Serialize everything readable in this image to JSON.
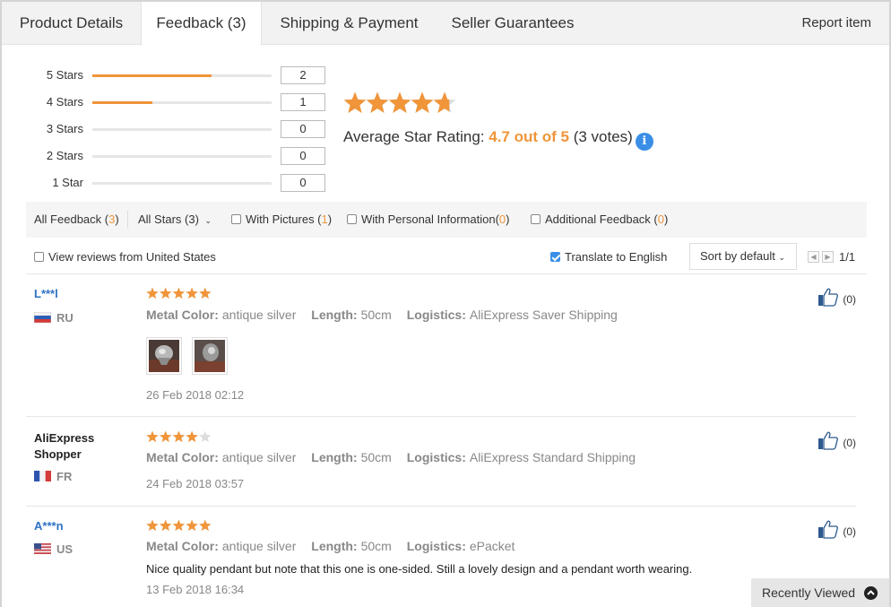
{
  "tabs": [
    {
      "label": "Product Details"
    },
    {
      "label": "Feedback (3)"
    },
    {
      "label": "Shipping & Payment"
    },
    {
      "label": "Seller Guarantees"
    }
  ],
  "active_tab": "Feedback (3)",
  "report_label": "Report item",
  "rating_histogram": [
    {
      "label": "5 Stars",
      "count": "2",
      "fill_fraction": 0.667
    },
    {
      "label": "4 Stars",
      "count": "1",
      "fill_fraction": 0.333
    },
    {
      "label": "3 Stars",
      "count": "0",
      "fill_fraction": 0
    },
    {
      "label": "2 Stars",
      "count": "0",
      "fill_fraction": 0
    },
    {
      "label": "1 Star",
      "count": "0",
      "fill_fraction": 0
    }
  ],
  "average": {
    "stars": 4.7,
    "label": "Average Star Rating:",
    "score": "4.7 out of 5",
    "votes": "(3 votes)",
    "info_icon": "info-icon"
  },
  "filters": {
    "all_feedback_label": "All Feedback (",
    "all_feedback_count": "3",
    "all_stars": "All Stars (3)",
    "with_pictures_label": "With Pictures (",
    "with_pictures_count": "1",
    "with_personal_label": "With Personal Information(",
    "with_personal_count": "0",
    "additional_label": "Additional Feedback (",
    "additional_count": "0",
    "close_paren": ")"
  },
  "subbar": {
    "view_us": "View reviews from United States",
    "translate": "Translate to English",
    "translate_checked": true,
    "sort": "Sort by default",
    "page": "1/1"
  },
  "colors": {
    "accent_orange": "#f0953a",
    "link_blue": "#2e72c2",
    "star_empty": "#dddddd"
  },
  "reviews": [
    {
      "name": "L***l",
      "country": "RU",
      "stars": 5,
      "metal_label": "Metal Color:",
      "metal": "antique silver",
      "length_label": "Length:",
      "length": "50cm",
      "logistics_label": "Logistics:",
      "logistics": "AliExpress Saver Shipping",
      "date": "26 Feb 2018 02:12",
      "helpful": "(0)",
      "photos": 2
    },
    {
      "name_line1": "AliExpress",
      "name_line2": "Shopper",
      "country": "FR",
      "stars": 4,
      "metal_label": "Metal Color:",
      "metal": "antique silver",
      "length_label": "Length:",
      "length": "50cm",
      "logistics_label": "Logistics:",
      "logistics": "AliExpress Standard Shipping",
      "date": "24 Feb 2018 03:57",
      "helpful": "(0)"
    },
    {
      "name": "A***n",
      "country": "US",
      "stars": 5,
      "metal_label": "Metal Color:",
      "metal": "antique silver",
      "length_label": "Length:",
      "length": "50cm",
      "logistics_label": "Logistics:",
      "logistics": "ePacket",
      "comment": "Nice quality pendant but note that this one is one-sided. Still a lovely design and a pendant worth wearing.",
      "date": "13 Feb 2018 16:34",
      "helpful": "(0)"
    }
  ],
  "recently_viewed": "Recently Viewed"
}
